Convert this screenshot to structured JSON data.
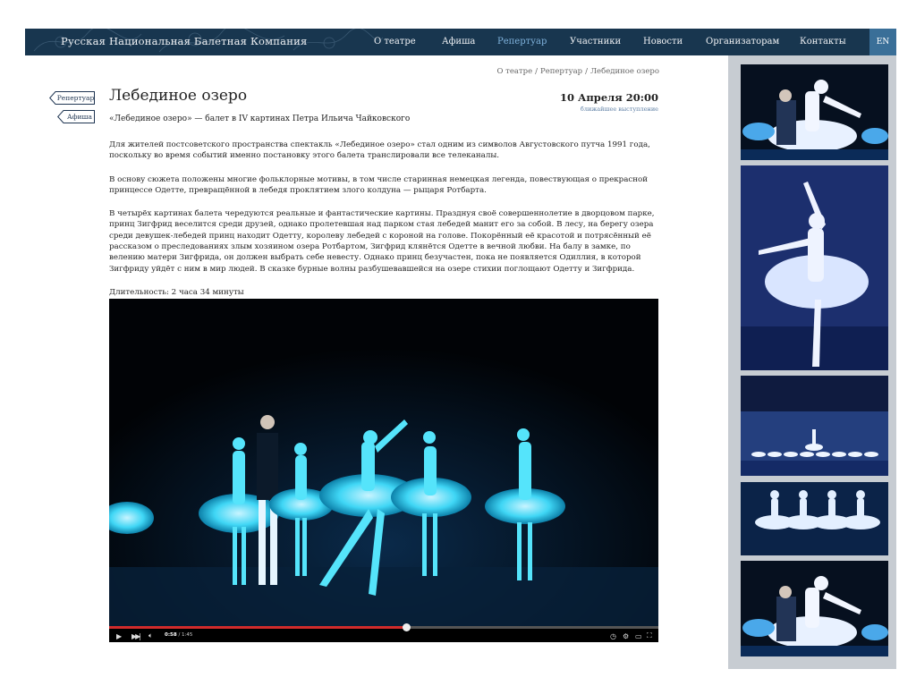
{
  "header": {
    "brand": "Русская Национальная Балетная Компания",
    "nav": [
      {
        "label": "О театре",
        "active": false
      },
      {
        "label": "Афиша",
        "active": false
      },
      {
        "label": "Репертуар",
        "active": true
      },
      {
        "label": "Участники",
        "active": false
      },
      {
        "label": "Новости",
        "active": false
      },
      {
        "label": "Организаторам",
        "active": false
      },
      {
        "label": "Контакты",
        "active": false
      }
    ],
    "lang": "EN"
  },
  "breadcrumb": [
    "О театре",
    "Репертуар",
    "Лебединое озеро"
  ],
  "side_buttons": [
    "Репертуар",
    "Афиша"
  ],
  "page": {
    "title": "Лебединое озеро",
    "subtitle": "«Лебединое озеро» — балет в IV картинах Петра Ильича Чайковского",
    "date": "10 Апреля 20:00",
    "date_note": "ближайшее выступление",
    "paragraphs": [
      "Для жителей постсоветского пространства спектакль «Лебединое озеро» стал одним из символов Августовского путча 1991 года, поскольку во время событий именно постановку этого балета транслировали все телеканалы.",
      "В основу сюжета положены многие фольклорные мотивы, в том числе старинная немецкая легенда, повествующая о прекрасной принцессе Одетте, превращённой в лебедя проклятием злого колдуна — рыцаря Ротбарта.",
      "В четырёх картинах балета чередуются реальные и фантастические картины. Празднуя своё совершеннолетие в дворцовом парке, принц Зигфрид веселится среди друзей, однако пролетевшая над парком стая лебедей манит его за собой. В лесу, на берегу озера среди девушек-лебедей принц находит Одетту, королеву лебедей с короной на голове. Покорённый её красотой и потрясённый её рассказом о преследованиях злым хозяином озера Ротбартом, Зигфрид клянётся Одетте в вечной любви. На балу в замке, по велению матери Зигфрида, он должен выбрать себе невесту. Однако принц безучастен, пока не появляется Одиллия, в которой Зигфриду  уйдёт с ним в мир людей. В сказке бурные волны разбушевавшейся на озере стихии поглощают Одетту и Зигфрида.",
      "Длительность: 2 часа 34 минуты"
    ]
  },
  "video": {
    "current_time": "0:58",
    "total_time": "/ 1:45",
    "progress": 0.54,
    "controls": [
      "play-icon",
      "next-icon",
      "volume-icon",
      "clock-icon",
      "settings-icon",
      "miniplayer-icon",
      "fullscreen-icon"
    ]
  },
  "gallery": {
    "thumbnails": [
      "ballet-duet",
      "ballerina-solo",
      "corps-de-ballet-stage",
      "four-swans",
      "ballet-duet-repeat"
    ]
  },
  "colors": {
    "header_bg": "#18364f",
    "nav_active": "#7fb2dc",
    "lang_bg": "#3a6f98",
    "gallery_bg": "#c7ccd2",
    "progress": "#d12b2b"
  }
}
